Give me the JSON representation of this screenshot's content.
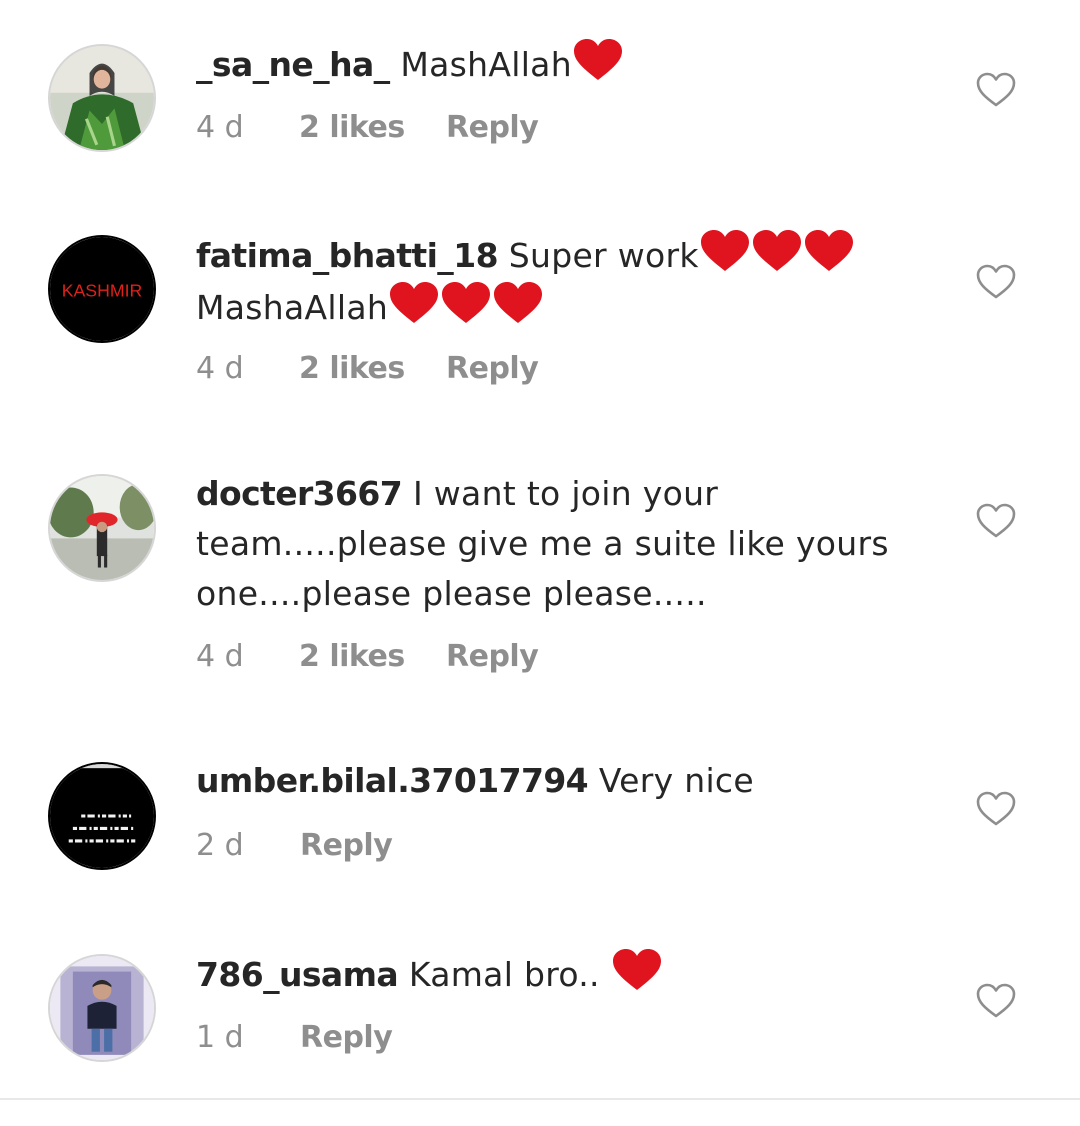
{
  "comments": [
    {
      "username": "_sa_ne_ha_",
      "text_parts": [
        "MashAllah"
      ],
      "time": "4 d",
      "likes": "2 likes",
      "reply": "Reply"
    },
    {
      "username": "fatima_bhatti_18",
      "text_parts": [
        "Super work",
        "MashaAllah"
      ],
      "time": "4 d",
      "likes": "2 likes",
      "reply": "Reply",
      "avatar_text": "KASHMIR"
    },
    {
      "username": "docter3667",
      "text_parts": [
        "I want to join your",
        "team.....please give me a suite like yours",
        "one....please please please....."
      ],
      "time": "4 d",
      "likes": "2 likes",
      "reply": "Reply"
    },
    {
      "username": "umber.bilal.37017794",
      "text_parts": [
        "Very nice"
      ],
      "time": "2 d",
      "reply": "Reply"
    },
    {
      "username": "786_usama",
      "text_parts": [
        "Kamal bro.."
      ],
      "time": "1 d",
      "reply": "Reply"
    }
  ],
  "icons": {
    "like": "heart-outline-icon",
    "emoji": "red-heart-emoji"
  },
  "colors": {
    "text": "#262626",
    "meta": "#8e8e8e",
    "emoji_heart": "#e0141e",
    "like_outline": "#8e8e8e"
  }
}
